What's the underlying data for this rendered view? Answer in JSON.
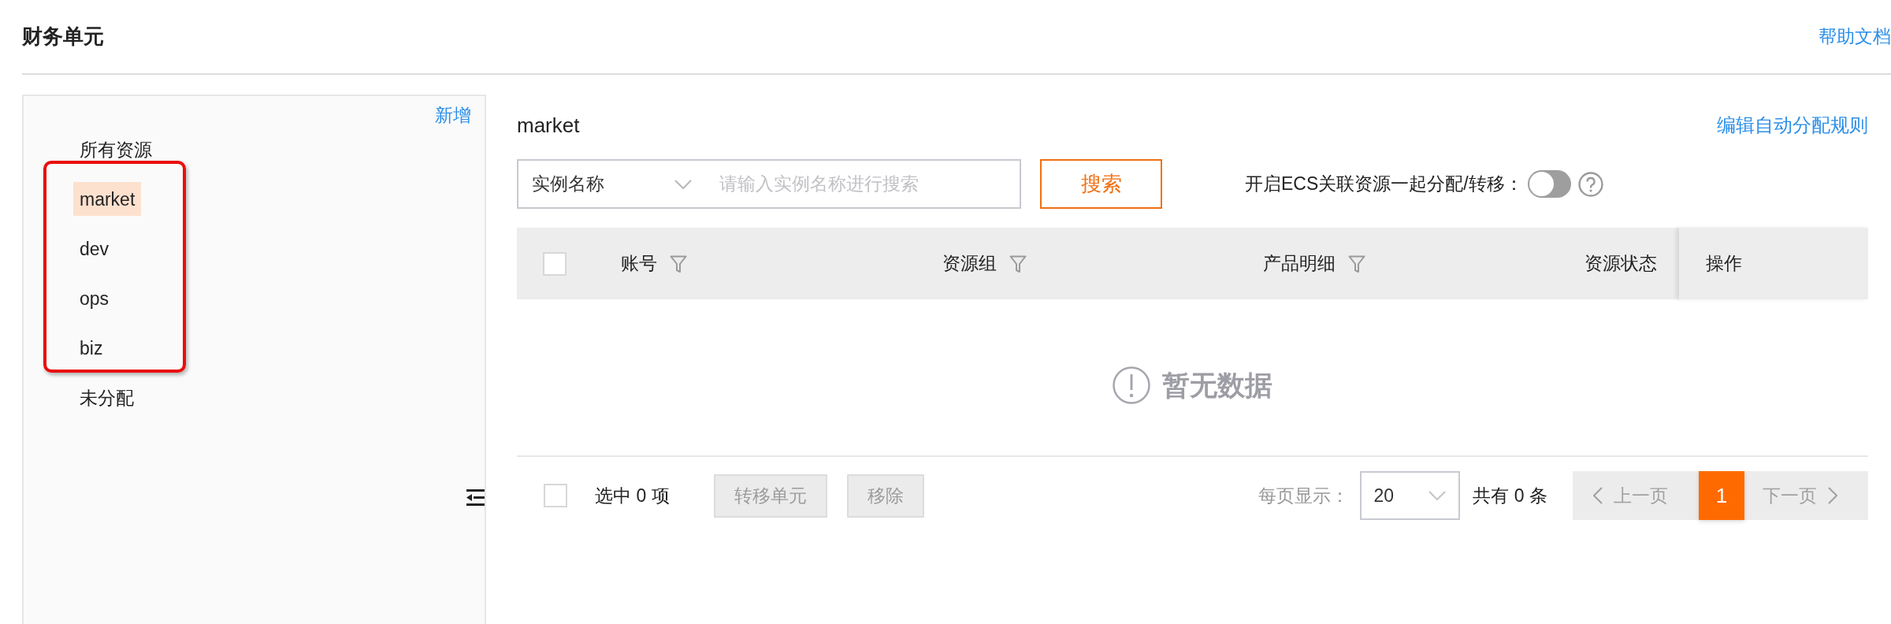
{
  "header": {
    "title": "财务单元",
    "help_link": "帮助文档"
  },
  "sidebar": {
    "add_link": "新增",
    "items": [
      {
        "label": "所有资源",
        "selected": false,
        "annotated": false
      },
      {
        "label": "market",
        "selected": true,
        "annotated": true
      },
      {
        "label": "dev",
        "selected": false,
        "annotated": true
      },
      {
        "label": "ops",
        "selected": false,
        "annotated": true
      },
      {
        "label": "biz",
        "selected": false,
        "annotated": true
      },
      {
        "label": "未分配",
        "selected": false,
        "annotated": false
      }
    ]
  },
  "panel": {
    "title": "market",
    "edit_rules_link": "编辑自动分配规则",
    "search": {
      "field": "实例名称",
      "placeholder": "请输入实例名称进行搜索",
      "button": "搜索"
    },
    "ecs_toggle": {
      "label": "开启ECS关联资源一起分配/转移：",
      "on": false
    },
    "table": {
      "all_checked": false,
      "columns": [
        {
          "label": "账号",
          "kind": "filter"
        },
        {
          "label": "资源组",
          "kind": "filter"
        },
        {
          "label": "产品明细",
          "kind": "filter"
        },
        {
          "label": "资源状态",
          "kind": "plain"
        },
        {
          "label": "操作",
          "kind": "fixed"
        }
      ],
      "empty_text": "暂无数据"
    }
  },
  "footer": {
    "all_checked": false,
    "selection": "选中 0 项",
    "buttons": [
      {
        "label": "转移单元",
        "disabled": true
      },
      {
        "label": "移除",
        "disabled": true
      }
    ],
    "page_size_label": "每页显示：",
    "page_size": "20",
    "total": "共有 0 条",
    "prev": {
      "label": "上一页",
      "disabled": true
    },
    "pages": [
      {
        "label": "1",
        "selected": true
      }
    ],
    "next": {
      "label": "下一页",
      "disabled": true
    }
  }
}
